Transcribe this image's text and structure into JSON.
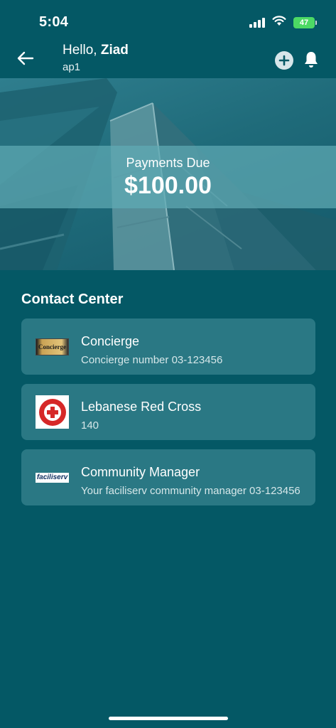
{
  "status_bar": {
    "time": "5:04",
    "battery": "47"
  },
  "header": {
    "greeting": "Hello,",
    "user_name": "Ziad",
    "unit": "ap1"
  },
  "hero": {
    "payments_label": "Payments Due",
    "payments_amount": "$100.00"
  },
  "contact_center": {
    "title": "Contact Center",
    "items": [
      {
        "title": "Concierge",
        "subtitle": "Concierge number 03-123456",
        "logo_text": "Concierge"
      },
      {
        "title": "Lebanese Red Cross",
        "subtitle": "140"
      },
      {
        "title": "Community Manager",
        "subtitle": "Your faciliserv community manager 03-123456",
        "logo_text": "faciliserv"
      }
    ]
  },
  "colors": {
    "background": "#045865",
    "card": "#2a7884",
    "battery": "#4cd964"
  },
  "icons": [
    "back-arrow-icon",
    "add-icon",
    "bell-icon",
    "signal-icon",
    "wifi-icon",
    "battery-icon"
  ]
}
